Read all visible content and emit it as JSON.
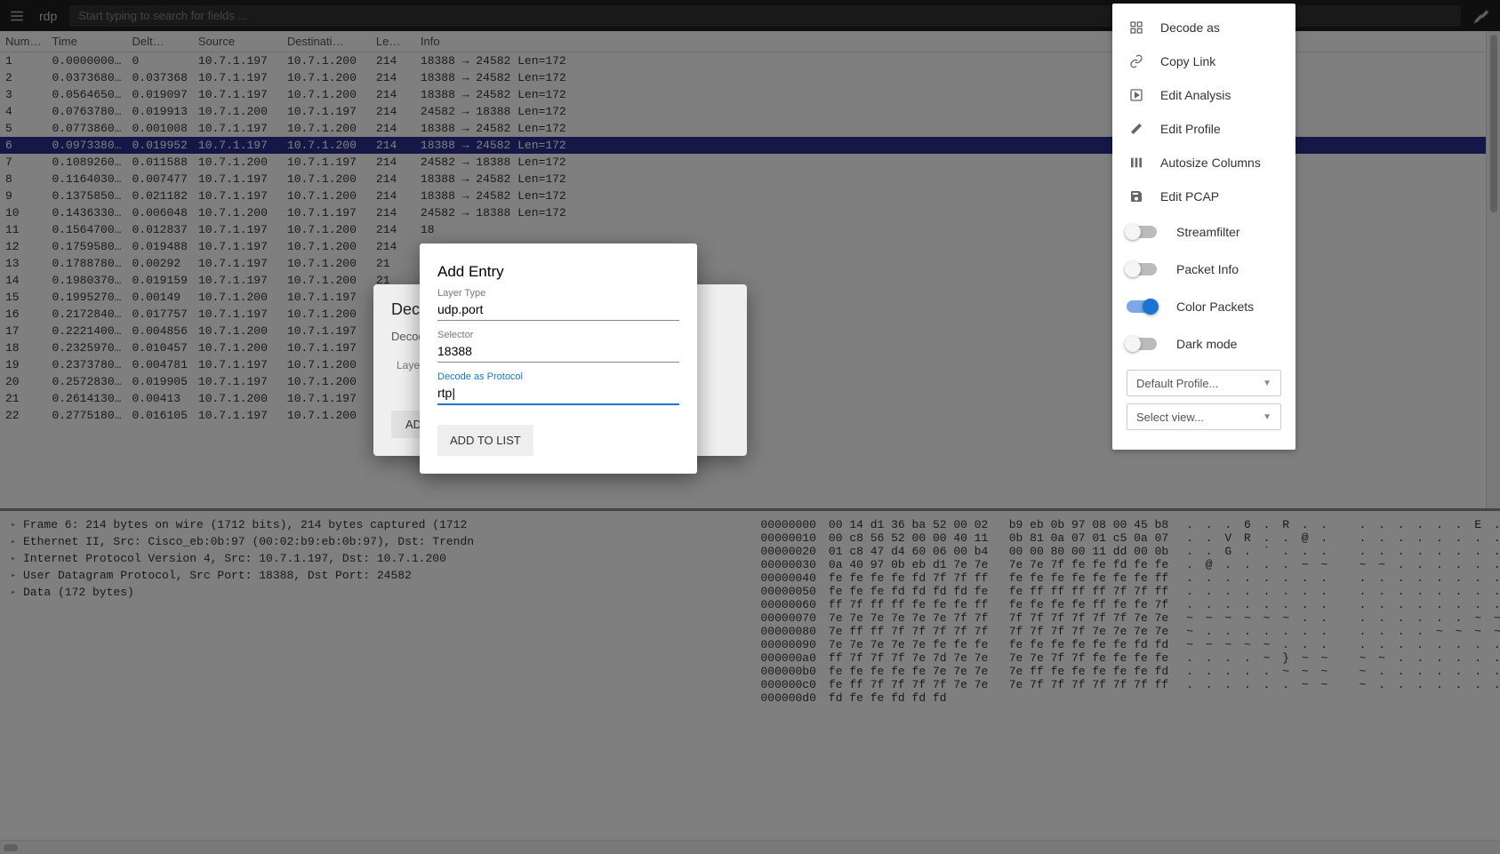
{
  "topbar": {
    "app_name": "rdp",
    "search_placeholder": "Start typing to search for fields ..."
  },
  "columns": [
    "Num…",
    "Time",
    "Delt…",
    "Source",
    "Destinati…",
    "Le…",
    "Info"
  ],
  "rows": [
    {
      "num": "1",
      "time": "0.0000000…",
      "delta": "0",
      "src": "10.7.1.197",
      "dst": "10.7.1.200",
      "len": "214",
      "info": "18388 → 24582 Len=172",
      "sel": false
    },
    {
      "num": "2",
      "time": "0.0373680…",
      "delta": "0.037368",
      "src": "10.7.1.197",
      "dst": "10.7.1.200",
      "len": "214",
      "info": "18388 → 24582 Len=172",
      "sel": false
    },
    {
      "num": "3",
      "time": "0.0564650…",
      "delta": "0.019097",
      "src": "10.7.1.197",
      "dst": "10.7.1.200",
      "len": "214",
      "info": "18388 → 24582 Len=172",
      "sel": false
    },
    {
      "num": "4",
      "time": "0.0763780…",
      "delta": "0.019913",
      "src": "10.7.1.200",
      "dst": "10.7.1.197",
      "len": "214",
      "info": "24582 → 18388 Len=172",
      "sel": false
    },
    {
      "num": "5",
      "time": "0.0773860…",
      "delta": "0.001008",
      "src": "10.7.1.197",
      "dst": "10.7.1.200",
      "len": "214",
      "info": "18388 → 24582 Len=172",
      "sel": false
    },
    {
      "num": "6",
      "time": "0.0973380…",
      "delta": "0.019952",
      "src": "10.7.1.197",
      "dst": "10.7.1.200",
      "len": "214",
      "info": "18388 → 24582 Len=172",
      "sel": true
    },
    {
      "num": "7",
      "time": "0.1089260…",
      "delta": "0.011588",
      "src": "10.7.1.200",
      "dst": "10.7.1.197",
      "len": "214",
      "info": "24582 → 18388 Len=172",
      "sel": false
    },
    {
      "num": "8",
      "time": "0.1164030…",
      "delta": "0.007477",
      "src": "10.7.1.197",
      "dst": "10.7.1.200",
      "len": "214",
      "info": "18388 → 24582 Len=172",
      "sel": false
    },
    {
      "num": "9",
      "time": "0.1375850…",
      "delta": "0.021182",
      "src": "10.7.1.197",
      "dst": "10.7.1.200",
      "len": "214",
      "info": "18388 → 24582 Len=172",
      "sel": false
    },
    {
      "num": "10",
      "time": "0.1436330…",
      "delta": "0.006048",
      "src": "10.7.1.200",
      "dst": "10.7.1.197",
      "len": "214",
      "info": "24582 → 18388 Len=172",
      "sel": false
    },
    {
      "num": "11",
      "time": "0.1564700…",
      "delta": "0.012837",
      "src": "10.7.1.197",
      "dst": "10.7.1.200",
      "len": "214",
      "info": "18",
      "sel": false
    },
    {
      "num": "12",
      "time": "0.1759580…",
      "delta": "0.019488",
      "src": "10.7.1.197",
      "dst": "10.7.1.200",
      "len": "214",
      "info": "",
      "sel": false
    },
    {
      "num": "13",
      "time": "0.1788780…",
      "delta": "0.00292",
      "src": "10.7.1.197",
      "dst": "10.7.1.200",
      "len": "21",
      "info": "",
      "sel": false
    },
    {
      "num": "14",
      "time": "0.1980370…",
      "delta": "0.019159",
      "src": "10.7.1.197",
      "dst": "10.7.1.200",
      "len": "21",
      "info": "",
      "sel": false
    },
    {
      "num": "15",
      "time": "0.1995270…",
      "delta": "0.00149",
      "src": "10.7.1.200",
      "dst": "10.7.1.197",
      "len": "21",
      "info": "",
      "sel": false
    },
    {
      "num": "16",
      "time": "0.2172840…",
      "delta": "0.017757",
      "src": "10.7.1.197",
      "dst": "10.7.1.200",
      "len": "21",
      "info": "",
      "sel": false
    },
    {
      "num": "17",
      "time": "0.2221400…",
      "delta": "0.004856",
      "src": "10.7.1.200",
      "dst": "10.7.1.197",
      "len": "21",
      "info": "",
      "sel": false
    },
    {
      "num": "18",
      "time": "0.2325970…",
      "delta": "0.010457",
      "src": "10.7.1.200",
      "dst": "10.7.1.197",
      "len": "21",
      "info": "",
      "sel": false
    },
    {
      "num": "19",
      "time": "0.2373780…",
      "delta": "0.004781",
      "src": "10.7.1.197",
      "dst": "10.7.1.200",
      "len": "21",
      "info": "",
      "sel": false
    },
    {
      "num": "20",
      "time": "0.2572830…",
      "delta": "0.019905",
      "src": "10.7.1.197",
      "dst": "10.7.1.200",
      "len": "21",
      "info": "",
      "sel": false
    },
    {
      "num": "21",
      "time": "0.2614130…",
      "delta": "0.00413",
      "src": "10.7.1.200",
      "dst": "10.7.1.197",
      "len": "21",
      "info": "",
      "sel": false
    },
    {
      "num": "22",
      "time": "0.2775180…",
      "delta": "0.016105",
      "src": "10.7.1.197",
      "dst": "10.7.1.200",
      "len": "21",
      "info": "",
      "sel": false
    }
  ],
  "detail_lines": [
    "Frame 6: 214 bytes on wire (1712 bits), 214 bytes captured (1712",
    "Ethernet II, Src: Cisco_eb:0b:97 (00:02:b9:eb:0b:97), Dst: Trendn",
    "Internet Protocol Version 4, Src: 10.7.1.197, Dst: 10.7.1.200",
    "User Datagram Protocol, Src Port: 18388, Dst Port: 24582",
    "Data (172 bytes)"
  ],
  "hex_rows": [
    {
      "addr": "00000000",
      "b1": "00 14 d1 36 ba 52 00 02",
      "b2": "b9 eb 0b 97 08 00 45 b8",
      "asc": ". . . 6 . R . .   . . . . . . E ."
    },
    {
      "addr": "00000010",
      "b1": "00 c8 56 52 00 00 40 11",
      "b2": "0b 81 0a 07 01 c5 0a 07",
      "asc": ". . V R . . @ .   . . . . . . . ."
    },
    {
      "addr": "00000020",
      "b1": "01 c8 47 d4 60 06 00 b4",
      "b2": "00 00 80 00 11 dd 00 0b",
      "asc": ". . G . ` . . .   . . . . . . . ."
    },
    {
      "addr": "00000030",
      "b1": "0a 40 97 0b eb d1 7e 7e",
      "b2": "7e 7e 7f fe fe fd fe fe",
      "asc": ". @ . . . . ~ ~   ~ ~ . . . . . ."
    },
    {
      "addr": "00000040",
      "b1": "fe fe fe fe fd 7f 7f ff",
      "b2": "fe fe fe fe fe fe fe ff",
      "asc": ". . . . . . . .   . . . . . . . ."
    },
    {
      "addr": "00000050",
      "b1": "fe fe fe fd fd fd fd fe",
      "b2": "fe ff ff ff ff 7f 7f ff",
      "asc": ". . . . . . . .   . . . . . . . ."
    },
    {
      "addr": "00000060",
      "b1": "ff 7f ff ff fe fe fe ff",
      "b2": "fe fe fe fe ff fe fe 7f",
      "asc": ". . . . . . . .   . . . . . . . ."
    },
    {
      "addr": "00000070",
      "b1": "7e 7e 7e 7e 7e 7e 7f 7f",
      "b2": "7f 7f 7f 7f 7f 7f 7e 7e",
      "asc": "~ ~ ~ ~ ~ ~ . .   . . . . . . ~ ~"
    },
    {
      "addr": "00000080",
      "b1": "7e ff ff 7f 7f 7f 7f 7f",
      "b2": "7f 7f 7f 7f 7e 7e 7e 7e",
      "asc": "~ . . . . . . .   . . . . ~ ~ ~ ~"
    },
    {
      "addr": "00000090",
      "b1": "7e 7e 7e 7e 7e fe fe fe",
      "b2": "fe fe fe fe fe fe fd fd",
      "asc": "~ ~ ~ ~ ~ . . .   . . . . . . . ."
    },
    {
      "addr": "000000a0",
      "b1": "ff 7f 7f 7f 7e 7d 7e 7e",
      "b2": "7e 7e 7f 7f fe fe fe fe",
      "asc": ". . . . ~ } ~ ~   ~ ~ . . . . . ."
    },
    {
      "addr": "000000b0",
      "b1": "fe fe fe fe fe 7e 7e 7e",
      "b2": "7e ff fe fe fe fe fe fd",
      "asc": ". . . . . ~ ~ ~   ~ . . . . . . ."
    },
    {
      "addr": "000000c0",
      "b1": "fe ff 7f 7f 7f 7f 7e 7e",
      "b2": "7e 7f 7f 7f 7f 7f 7f ff",
      "asc": ". . . . . . ~ ~   ~ . . . . . . ."
    },
    {
      "addr": "000000d0",
      "b1": "fd fe fe fd fd fd",
      "b2": "",
      "asc": ""
    }
  ],
  "side_menu": {
    "items": [
      {
        "icon": "grid",
        "label": "Decode as"
      },
      {
        "icon": "link",
        "label": "Copy Link"
      },
      {
        "icon": "play",
        "label": "Edit Analysis"
      },
      {
        "icon": "pencil",
        "label": "Edit Profile"
      },
      {
        "icon": "columns",
        "label": "Autosize Columns"
      },
      {
        "icon": "save",
        "label": "Edit PCAP"
      }
    ],
    "toggles": [
      {
        "label": "Streamfilter",
        "on": false
      },
      {
        "label": "Packet Info",
        "on": false
      },
      {
        "label": "Color Packets",
        "on": true
      },
      {
        "label": "Dark mode",
        "on": false
      }
    ],
    "selects": [
      "Default Profile...",
      "Select view..."
    ]
  },
  "decode_dialog": {
    "title": "Dec",
    "hint": "Decode",
    "col": "Layer",
    "add_btn": "ADD"
  },
  "entry_dialog": {
    "title": "Add Entry",
    "layer_label": "Layer Type",
    "layer_value": "udp.port",
    "selector_label": "Selector",
    "selector_value": "18388",
    "protocol_label": "Decode as Protocol",
    "protocol_value": "rtp|",
    "button": "ADD TO LIST"
  }
}
